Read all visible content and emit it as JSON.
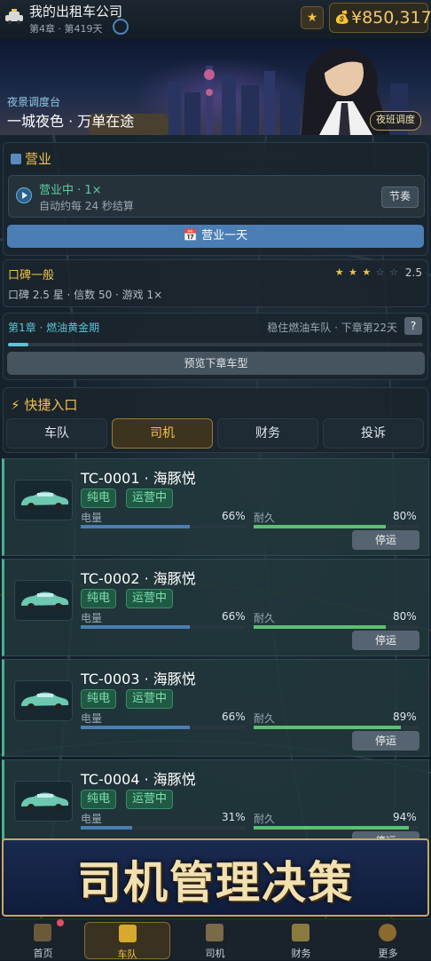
{
  "header": {
    "company": "我的出租车公司",
    "chapter_day": "第4章 · 第419天",
    "money": "¥850,317"
  },
  "banner": {
    "subtitle": "夜景调度台",
    "title": "一城夜色 · 万单在途",
    "night_button": "夜班调度"
  },
  "business": {
    "title": "营业",
    "status": "营业中 · 1×",
    "desc": "自动约每 24 秒结算",
    "rhythm_button": "节奏",
    "one_day_button": "营业一天"
  },
  "reputation": {
    "title": "口碑一般",
    "stars_on": "★ ★ ★",
    "stars_off": " ☆ ☆",
    "score": "2.5",
    "desc": "口碑 2.5 星 · 信数 50 · 游戏 1×"
  },
  "chapter": {
    "title": "第1章 · 燃油黄金期",
    "right": "稳住燃油车队 · 下章第22天",
    "help": "?",
    "progress": 0.05,
    "preview_button": "预览下章车型"
  },
  "quick": {
    "title": "快捷入口",
    "tabs": [
      "车队",
      "司机",
      "财务",
      "投诉"
    ],
    "active": 1
  },
  "drivers": [
    {
      "plate": "TC-0001 · 海豚悦",
      "tags": [
        "纯电",
        "运营中"
      ],
      "power_label": "电量",
      "power": "66%",
      "power_frac": 0.66,
      "dur_label": "耐久",
      "dur": "80%",
      "dur_frac": 0.8,
      "button": "停运"
    },
    {
      "plate": "TC-0002 · 海豚悦",
      "tags": [
        "纯电",
        "运营中"
      ],
      "power_label": "电量",
      "power": "66%",
      "power_frac": 0.66,
      "dur_label": "耐久",
      "dur": "80%",
      "dur_frac": 0.8,
      "button": "停运"
    },
    {
      "plate": "TC-0003 · 海豚悦",
      "tags": [
        "纯电",
        "运营中"
      ],
      "power_label": "电量",
      "power": "66%",
      "power_frac": 0.66,
      "dur_label": "耐久",
      "dur": "89%",
      "dur_frac": 0.89,
      "button": "停运"
    },
    {
      "plate": "TC-0004 · 海豚悦",
      "tags": [
        "纯电",
        "运营中"
      ],
      "power_label": "电量",
      "power": "31%",
      "power_frac": 0.31,
      "dur_label": "耐久",
      "dur": "94%",
      "dur_frac": 0.94,
      "button": "停运"
    }
  ],
  "promo": {
    "text": "司机管理决策"
  },
  "nav": {
    "items": [
      "首页",
      "车队",
      "司机",
      "财务",
      "更多"
    ],
    "active": 1
  },
  "colors": {
    "accent": "#f2c14a",
    "success": "#5ccca0",
    "primary": "#4a7eb4"
  }
}
